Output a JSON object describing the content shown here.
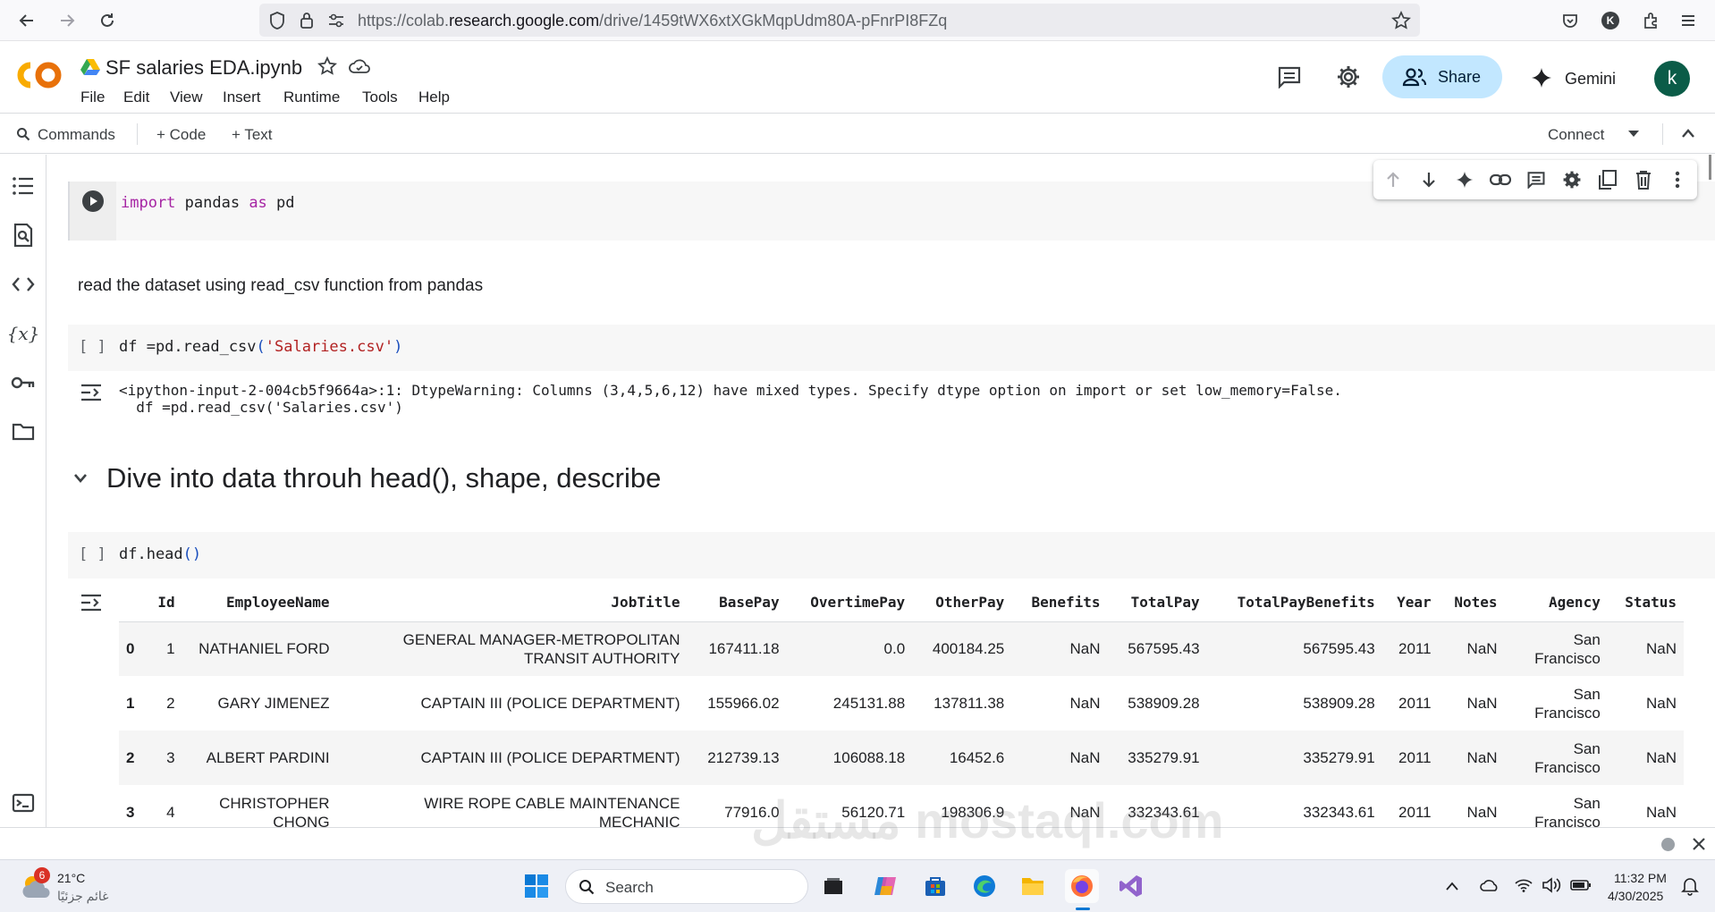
{
  "browser": {
    "url_prefix": "https://colab.",
    "url_domain": "research.google.com",
    "url_path": "/drive/1459tWX6xtXGkMqpUdm80A-pFnrPI8FZq"
  },
  "header": {
    "logo": "CO",
    "title": "SF salaries EDA.ipynb",
    "menu": [
      "File",
      "Edit",
      "View",
      "Insert",
      "Runtime",
      "Tools",
      "Help"
    ],
    "share_label": "Share",
    "gemini_label": "Gemini",
    "avatar_letter": "k"
  },
  "toolbar": {
    "commands_label": "Commands",
    "add_code_label": "+ Code",
    "add_text_label": "+ Text",
    "connect_label": "Connect"
  },
  "cells": {
    "cell1": {
      "kw1": "import",
      "mid": " pandas ",
      "kw2": "as",
      "end": " pd"
    },
    "md1": "read the dataset using read_csv function from pandas",
    "cell2": {
      "bracket": "[ ]",
      "pre": "df =pd.read_csv",
      "open": "(",
      "str": "'Salaries.csv'",
      "close": ")"
    },
    "cell2_output": [
      "<ipython-input-2-004cb5f9664a>:1: DtypeWarning: Columns (3,4,5,6,12) have mixed types. Specify dtype option on import or set low_memory=False.",
      "  df =pd.read_csv('Salaries.csv')"
    ],
    "heading": "Dive into data throuh head(), shape, describe",
    "cell3": {
      "bracket": "[ ]",
      "pre": "df.head",
      "parens": "()"
    }
  },
  "dataframe": {
    "columns": [
      "",
      "Id",
      "EmployeeName",
      "JobTitle",
      "BasePay",
      "OvertimePay",
      "OtherPay",
      "Benefits",
      "TotalPay",
      "TotalPayBenefits",
      "Year",
      "Notes",
      "Agency",
      "Status"
    ],
    "rows": [
      [
        "0",
        "1",
        "NATHANIEL FORD",
        "GENERAL MANAGER-METROPOLITAN TRANSIT AUTHORITY",
        "167411.18",
        "0.0",
        "400184.25",
        "NaN",
        "567595.43",
        "567595.43",
        "2011",
        "NaN",
        "San Francisco",
        "NaN"
      ],
      [
        "1",
        "2",
        "GARY JIMENEZ",
        "CAPTAIN III (POLICE DEPARTMENT)",
        "155966.02",
        "245131.88",
        "137811.38",
        "NaN",
        "538909.28",
        "538909.28",
        "2011",
        "NaN",
        "San Francisco",
        "NaN"
      ],
      [
        "2",
        "3",
        "ALBERT PARDINI",
        "CAPTAIN III (POLICE DEPARTMENT)",
        "212739.13",
        "106088.18",
        "16452.6",
        "NaN",
        "335279.91",
        "335279.91",
        "2011",
        "NaN",
        "San Francisco",
        "NaN"
      ],
      [
        "3",
        "4",
        "CHRISTOPHER CHONG",
        "WIRE ROPE CABLE MAINTENANCE MECHANIC",
        "77916.0",
        "56120.71",
        "198306.9",
        "NaN",
        "332343.61",
        "332343.61",
        "2011",
        "NaN",
        "San Francisco",
        "NaN"
      ]
    ]
  },
  "taskbar": {
    "weather_badge": "6",
    "temperature": "21°C",
    "weather_desc": "غائم جزئيًا",
    "search_label": "Search",
    "time": "11:32 PM",
    "date": "4/30/2025"
  },
  "watermark": "مستقل mostaql.com",
  "colors": {
    "share_bg": "#c2e7ff",
    "avatar_bg": "#0b5c48",
    "keyword": "#a625a4",
    "string": "#b22222",
    "logo_orange": "#f9ab00"
  },
  "icons": [
    "back-icon",
    "forward-icon",
    "reload-icon",
    "shield-icon",
    "lock-icon",
    "site-settings-icon",
    "bookmark-star-icon",
    "pocket-icon",
    "profile-icon",
    "extensions-icon",
    "menu-icon",
    "drive-icon",
    "star-icon",
    "cloud-icon",
    "comment-icon",
    "gear-icon",
    "people-icon",
    "sparkle-icon",
    "search-icon",
    "chevron-down-icon",
    "chevron-up-icon",
    "toc-icon",
    "find-icon",
    "code-icon",
    "variables-icon",
    "key-icon",
    "folder-icon",
    "terminal-icon",
    "run-icon",
    "arrow-up-icon",
    "arrow-down-icon",
    "link-icon",
    "trash-icon",
    "more-icon"
  ]
}
